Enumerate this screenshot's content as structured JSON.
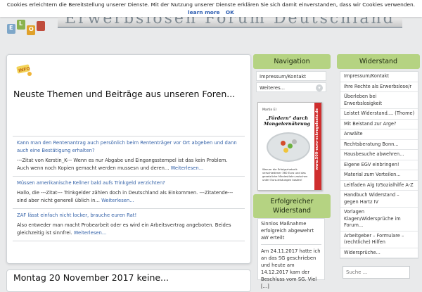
{
  "cookie": {
    "text": "Cookies erleichtern die Bereitstellung unserer Dienste. Mit der Nutzung unserer Dienste erklären Sie sich damit einverstanden, dass wir Cookies verwenden.",
    "learn_more": "learn more",
    "ok": "OK"
  },
  "header": {
    "logo_letters": [
      "E",
      "L",
      "O"
    ],
    "banner_text": "Erwerbslosen Forum Deutschland"
  },
  "main": {
    "info_badge": "INFO",
    "title": "Neuste Themen und Beiträge aus unseren Foren...",
    "posts": [
      {
        "title": "Kann man den Rentenantrag auch persönlich beim Rententräger vor Ort abgeben und dann auch eine Bestätigung erhalten?",
        "body": "---Zitat von Kerstin_K--- Wenn es nur Abgabe und Eingangsstempel ist das kein Problem. Auch wenn noch Kopien gemacht werden mussesn und deren...",
        "more": "Weiterlesen..."
      },
      {
        "title": "Müssen amerikanische Kellner bald aufs Trinkgeld verzichten?",
        "body": "Hallo, die ---Zitat--- Trinkgelder zählen doch in Deutschland als Einkommen. ---Zitatende--- sind aber nicht generell üblich in...",
        "more": "Weiterlesen..."
      },
      {
        "title": "ZAF lässt einfach nicht locker, brauche euren Rat!",
        "body": "Also entweder man macht Probearbeit oder es wird ein Arbeitsvertrag angeboten. Beides gleichzeitig ist sinnfrei.",
        "more": "Weiterlesen..."
      }
    ],
    "next_title": "Montag 20 November 2017 keine..."
  },
  "navigation": {
    "heading": "Navigation",
    "items": [
      "Impressum/Kontakt",
      "Weiteres..."
    ]
  },
  "book": {
    "author": "Martin El",
    "title": "„Fördern“ durch Mangelernährung",
    "subtitle": "Warum die Erfolgsrhetorik verschiedener 360 Euro und das gesetzliche Mindestlohn zwischen unter Euro-leistungen kosten!",
    "spine": "www.500-euro-eckregelsatz.de"
  },
  "erfolg": {
    "heading": "Erfolgreicher Widerstand",
    "headline": "Sinnlos Maßnahme erfolgreich abgewehrt aW erteilt",
    "body": "Am 24.11.2017 hatte ich an das SG geschrieben und heute am 14.12.2017 kam der Beschluss vom SG. Viel [...]"
  },
  "widerstand": {
    "heading": "Widerstand",
    "items": [
      "Impressum/Kontakt",
      "Ihre Rechte als Erwerbslose/r",
      "Überleben bei Erwerbslosigkeit",
      "Leistet Widerstand.... (Thome)",
      "Mit Beistand zur Arge?",
      "Anwälte",
      "Rechtsberatung Bonn...",
      "Hausbesuche abwehren...",
      "Eigene EGV einbringen!",
      "Material zum Verteilen...",
      "Leitfaden Alg II/Sozialhilfe A-Z",
      "Handbuch Widerstand – gegen Hartz IV",
      "Vorlagen Klagen/Widersprüche im Forum...",
      "Arbeitgeber – Formulare – (rechtliche) Hilfen",
      "Widersprüche..."
    ]
  },
  "search": {
    "placeholder": "Suche ..."
  },
  "colors": {
    "accent_green": "#b5d382",
    "link_blue": "#3462a8",
    "background": "#e9eaeb"
  }
}
